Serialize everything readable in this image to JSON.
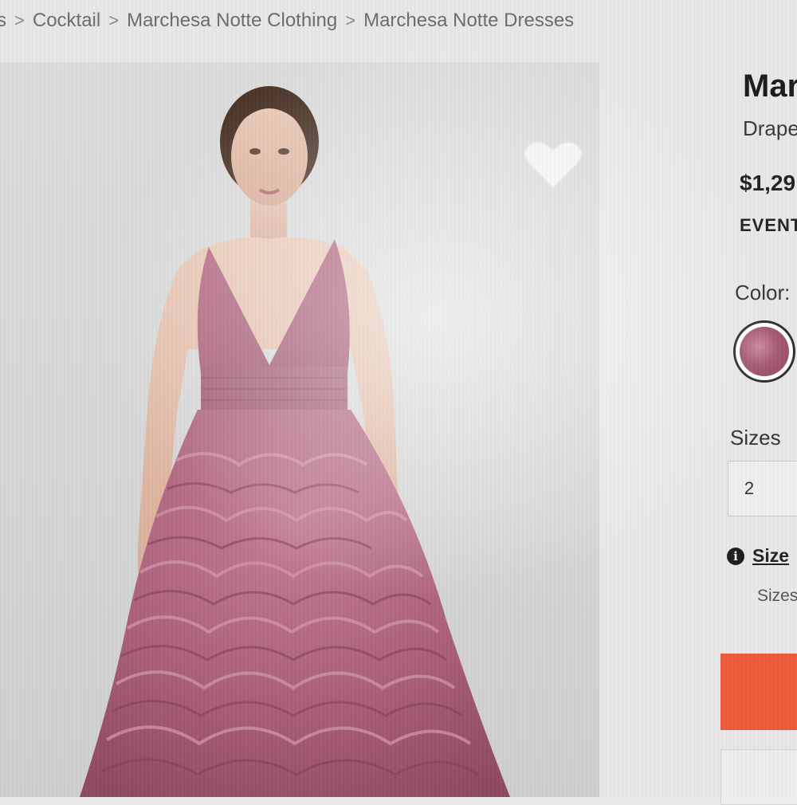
{
  "breadcrumb": {
    "items": [
      "s",
      "Cocktail",
      "Marchesa Notte Clothing",
      "Marchesa Notte Dresses"
    ],
    "separator": ">"
  },
  "product": {
    "brand": "Mar",
    "subtitle": "Drape",
    "price": "$1,29",
    "event_label": "EVENT",
    "color_label": "Color:",
    "color_swatch": {
      "icon": "color-swatch",
      "color": "#a65a74"
    },
    "sizes_label": "Sizes",
    "size_options": [
      "2"
    ],
    "size_guide_label": "Size",
    "size_note": "Sizes",
    "favorite_icon": "heart-icon",
    "info_icon": "info-icon",
    "info_glyph": "i"
  },
  "colors": {
    "cta": "#ee5a3c",
    "dress": "#b0657f",
    "background": "#e9e8e6"
  }
}
